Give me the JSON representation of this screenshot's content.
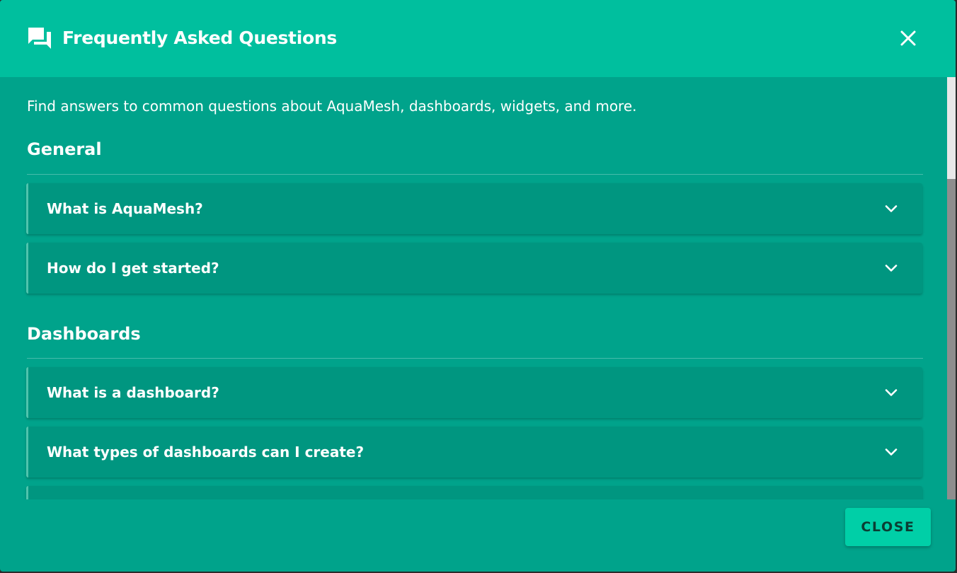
{
  "dialog": {
    "title": "Frequently Asked Questions",
    "icon": "forum-icon",
    "close_icon": "close-icon"
  },
  "intro": "Find answers to common questions about AquaMesh, dashboards, widgets, and more.",
  "sections": [
    {
      "title": "General",
      "items": [
        {
          "question": "What is AquaMesh?"
        },
        {
          "question": "How do I get started?"
        }
      ]
    },
    {
      "title": "Dashboards",
      "items": [
        {
          "question": "What is a dashboard?"
        },
        {
          "question": "What types of dashboards can I create?"
        }
      ]
    }
  ],
  "footer": {
    "close_label": "CLOSE"
  },
  "colors": {
    "header_bg": "#00bf9e",
    "body_bg": "#00a38b",
    "item_bg": "#009680",
    "button_bg": "#00cfa7"
  }
}
